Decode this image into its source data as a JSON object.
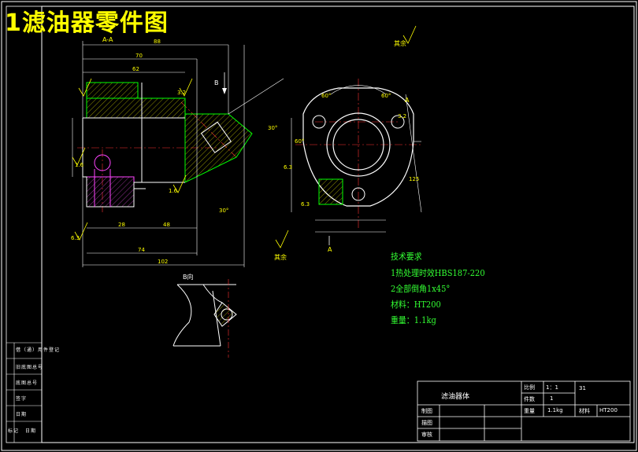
{
  "page_title": "1滤油器零件图",
  "views": {
    "section_label": "A-A",
    "b_arrow_label": "B",
    "b_view_label": "B向",
    "a_arrow_label": "A",
    "roughness_other_top": "其余",
    "roughness_other_bottom": "其余"
  },
  "dimensions": {
    "d70": "70",
    "d88": "88",
    "d62": "62",
    "d28": "28",
    "d48": "48",
    "d74": "74",
    "d102": "102",
    "a30_1": "30°",
    "a30_2": "30°",
    "a60_1": "60°",
    "a60_2": "60°",
    "a60_3": "60°",
    "d125": "125",
    "r1": "1.6",
    "r2": "3.2",
    "r3": "6.3",
    "r4": "1.6",
    "r5": "3.2",
    "r6": "6.3",
    "r7": "6.3"
  },
  "tech_requirements": {
    "heading": "技术要求",
    "items": [
      "1热处理时效HBS187-220",
      "2全部倒角1x45°",
      "材料：HT200",
      "重量：1.1kg"
    ]
  },
  "title_block": {
    "part_name": "滤油器体",
    "scale_label": "比例",
    "scale_value": "1：1",
    "qty_label": "件数",
    "qty_value": "1",
    "weight_label": "重量",
    "weight_value": "1.1kg",
    "material_label": "材料",
    "material_value": "HT200",
    "drawing_no": "31",
    "drawn_label": "制图",
    "check_label": "描图",
    "review_label": "审核"
  },
  "side_block": [
    "借（通）用件登记",
    "旧底图总号",
    "底图总号",
    "签字",
    "日期"
  ],
  "side_bottom": [
    "标记",
    "日期"
  ]
}
